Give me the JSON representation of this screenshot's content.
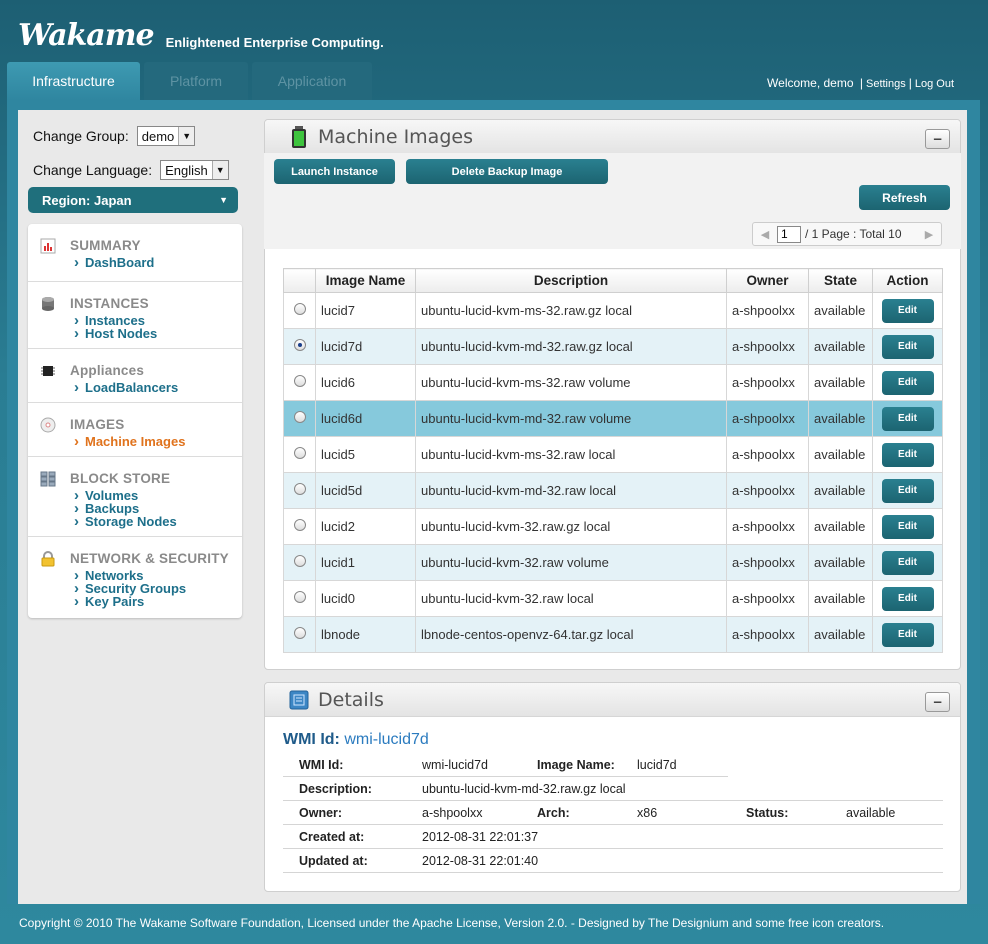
{
  "brand": {
    "logo": "Wakame",
    "tagline": "Enlightened Enterprise Computing."
  },
  "tabs": [
    {
      "label": "Infrastructure",
      "active": true
    },
    {
      "label": "Platform",
      "active": false
    },
    {
      "label": "Application",
      "active": false
    }
  ],
  "userbar": {
    "welcome": "Welcome, demo",
    "settings": "Settings",
    "logout": "Log Out",
    "sep": "|"
  },
  "sidebar": {
    "change_group_label": "Change Group:",
    "change_group_value": "demo",
    "change_language_label": "Change Language:",
    "change_language_value": "English",
    "region": "Region: Japan",
    "sections": [
      {
        "title": "SUMMARY",
        "icon": "chart-icon",
        "links": [
          "DashBoard"
        ]
      },
      {
        "title": "INSTANCES",
        "icon": "database-icon",
        "links": [
          "Instances",
          "Host Nodes"
        ]
      },
      {
        "title": "Appliances",
        "icon": "chip-icon",
        "links": [
          "LoadBalancers"
        ]
      },
      {
        "title": "IMAGES",
        "icon": "disc-icon",
        "links": [
          "Machine Images"
        ],
        "active_link": "Machine Images"
      },
      {
        "title": "BLOCK STORE",
        "icon": "storage-icon",
        "links": [
          "Volumes",
          "Backups",
          "Storage Nodes"
        ]
      },
      {
        "title": "NETWORK & SECURITY",
        "icon": "lock-icon",
        "links": [
          "Networks",
          "Security Groups",
          "Key Pairs"
        ]
      }
    ]
  },
  "machine_images": {
    "title": "Machine Images",
    "launch_label": "Launch Instance",
    "delete_label": "Delete Backup Image",
    "refresh_label": "Refresh",
    "pager": {
      "page": "1",
      "text": "/ 1 Page : Total 10"
    },
    "columns": [
      "Image Name",
      "Description",
      "Owner",
      "State",
      "Action"
    ],
    "edit_label": "Edit",
    "rows": [
      {
        "name": "lucid7",
        "description": "ubuntu-lucid-kvm-ms-32.raw.gz local",
        "owner": "a-shpoolxx",
        "state": "available",
        "selected": false
      },
      {
        "name": "lucid7d",
        "description": "ubuntu-lucid-kvm-md-32.raw.gz local",
        "owner": "a-shpoolxx",
        "state": "available",
        "selected": true
      },
      {
        "name": "lucid6",
        "description": "ubuntu-lucid-kvm-ms-32.raw volume",
        "owner": "a-shpoolxx",
        "state": "available",
        "selected": false
      },
      {
        "name": "lucid6d",
        "description": "ubuntu-lucid-kvm-md-32.raw volume",
        "owner": "a-shpoolxx",
        "state": "available",
        "selected": false
      },
      {
        "name": "lucid5",
        "description": "ubuntu-lucid-kvm-ms-32.raw local",
        "owner": "a-shpoolxx",
        "state": "available",
        "selected": false
      },
      {
        "name": "lucid5d",
        "description": "ubuntu-lucid-kvm-md-32.raw local",
        "owner": "a-shpoolxx",
        "state": "available",
        "selected": false
      },
      {
        "name": "lucid2",
        "description": "ubuntu-lucid-kvm-32.raw.gz local",
        "owner": "a-shpoolxx",
        "state": "available",
        "selected": false
      },
      {
        "name": "lucid1",
        "description": "ubuntu-lucid-kvm-32.raw volume",
        "owner": "a-shpoolxx",
        "state": "available",
        "selected": false
      },
      {
        "name": "lucid0",
        "description": "ubuntu-lucid-kvm-32.raw local",
        "owner": "a-shpoolxx",
        "state": "available",
        "selected": false
      },
      {
        "name": "lbnode",
        "description": "lbnode-centos-openvz-64.tar.gz local",
        "owner": "a-shpoolxx",
        "state": "available",
        "selected": false
      }
    ]
  },
  "details": {
    "title": "Details",
    "heading_label": "WMI Id:",
    "heading_value": "wmi-lucid7d",
    "wmi_id_label": "WMI Id:",
    "wmi_id": "wmi-lucid7d",
    "image_name_label": "Image Name:",
    "image_name": "lucid7d",
    "description_label": "Description:",
    "description": "ubuntu-lucid-kvm-md-32.raw.gz local",
    "owner_label": "Owner:",
    "owner": "a-shpoolxx",
    "arch_label": "Arch:",
    "arch": "x86",
    "status_label": "Status:",
    "status": "available",
    "created_label": "Created at:",
    "created": "2012-08-31 22:01:37",
    "updated_label": "Updated at:",
    "updated": "2012-08-31 22:01:40"
  },
  "footer": "Copyright © 2010 The Wakame Software Foundation, Licensed under the Apache License, Version 2.0. - Designed by The Designium and some free icon creators.",
  "colors": {
    "accent": "#1c6471",
    "link": "#1d6f8a",
    "active_link": "#e0731d",
    "selected_row": "#86c9dc"
  }
}
